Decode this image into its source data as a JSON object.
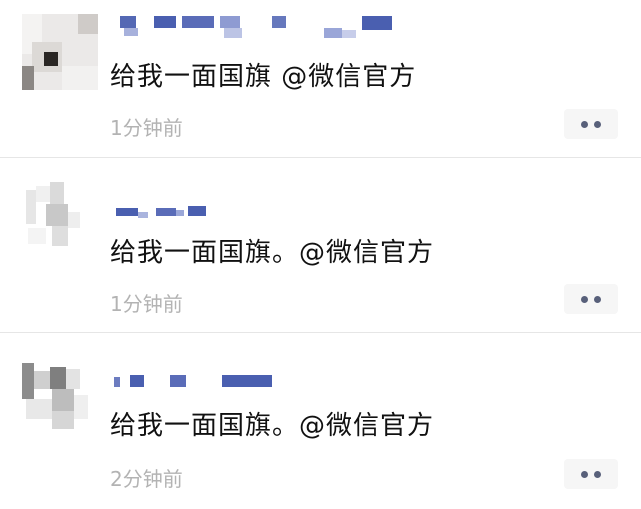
{
  "posts": [
    {
      "message": "给我一面国旗 @微信官方",
      "time": "1分钟前",
      "more_icon": "more-dots-icon"
    },
    {
      "message": "给我一面国旗。@微信官方",
      "time": "1分钟前",
      "more_icon": "more-dots-icon"
    },
    {
      "message": "给我一面国旗。@微信官方",
      "time": "2分钟前",
      "more_icon": "more-dots-icon"
    }
  ],
  "colors": {
    "text": "#111111",
    "timestamp": "#b3b3b3",
    "nickname_mosaic": "#4a5fb0",
    "more_button_bg": "#f6f6f6",
    "more_dots": "#58607a",
    "divider": "#e6e6e6"
  }
}
